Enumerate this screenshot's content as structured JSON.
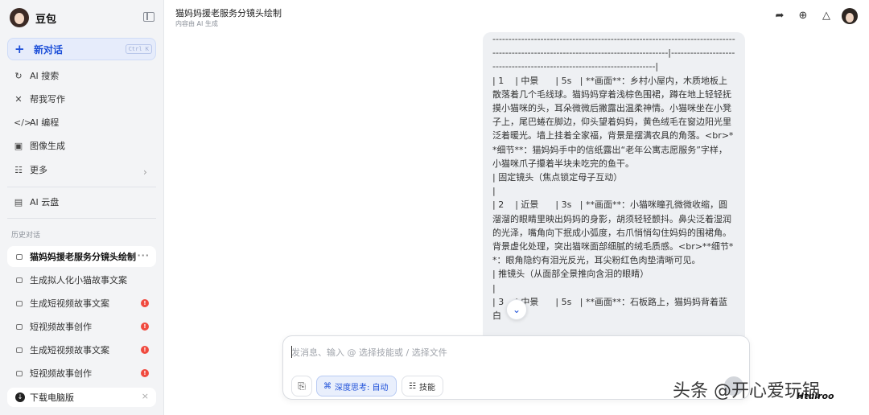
{
  "sidebar": {
    "brand": "豆包",
    "new_chat": {
      "label": "新对话",
      "shortcut": "Ctrl K"
    },
    "nav": [
      {
        "label": "AI 搜索",
        "icon": "search-icon"
      },
      {
        "label": "帮我写作",
        "icon": "pen-icon"
      },
      {
        "label": "AI 编程",
        "icon": "code-icon"
      },
      {
        "label": "图像生成",
        "icon": "image-icon"
      },
      {
        "label": "更多",
        "icon": "grid-icon"
      },
      {
        "label": "AI 云盘",
        "icon": "cloud-drive-icon"
      }
    ],
    "history_label": "历史对话",
    "history": [
      {
        "label": "猫妈妈援老服务分镜头绘制",
        "active": true
      },
      {
        "label": "生成拟人化小猫故事文案"
      },
      {
        "label": "生成短视频故事文案",
        "badge": "!"
      },
      {
        "label": "短视频故事创作",
        "badge": "!"
      },
      {
        "label": "生成短视频故事文案",
        "badge": "!"
      },
      {
        "label": "短视频故事创作",
        "badge": "!"
      }
    ],
    "download": "下载电脑版"
  },
  "header": {
    "title": "猫妈妈援老服务分镜头绘制",
    "subtitle": "内容由 AI 生成",
    "icons": [
      "share-icon",
      "new-window-icon",
      "bell-icon",
      "user-avatar"
    ]
  },
  "message": {
    "text": "-----------------------------------------------------------------------------------------------------------------------------------|-----------------------------------------------------------------------|\n| 1    | 中景      | 5s   | **画面**：乡村小屋内，木质地板上散落着几个毛线球。猫妈妈穿着浅棕色围裙，蹲在地上轻轻抚摸小猫咪的头，耳朵微微后撇露出温柔神情。小猫咪坐在小凳子上，尾巴蜷在脚边，仰头望着妈妈，黄色绒毛在窗边阳光里泛着暖光。墙上挂着全家福，背景是摆满农具的角落。<br>**细节**：猫妈妈手中的信纸露出“老年公寓志愿服务”字样，小猫咪爪子攥着半块未吃完的鱼干。\n| 固定镜头（焦点锁定母子互动）\n|\n| 2    | 近景      | 3s   | **画面**：小猫咪瞳孔微微收缩，圆溜溜的眼睛里映出妈妈的身影，胡须轻轻颤抖。鼻尖泛着湿润的光泽，嘴角向下抿成小弧度，右爪悄悄勾住妈妈的围裙角。背景虚化处理，突出猫咪面部细腻的绒毛质感。<br>**细节**：眼角隐约有泪光反光，耳尖粉红色肉垫清晰可见。\n| 推镜头（从面部全景推向含泪的眼睛）\n|\n| 3    | 中景      | 5s   | **画面**：石板路上，猫妈妈背着蓝白"
  },
  "composer": {
    "placeholder": "发消息、输入 @ 选择技能或 / 选择文件",
    "deep_think": "深度思考: 自动",
    "skills": "技能"
  },
  "watermark": {
    "main": "头条 @开心爱玩锅",
    "small": "Htuiroo"
  }
}
